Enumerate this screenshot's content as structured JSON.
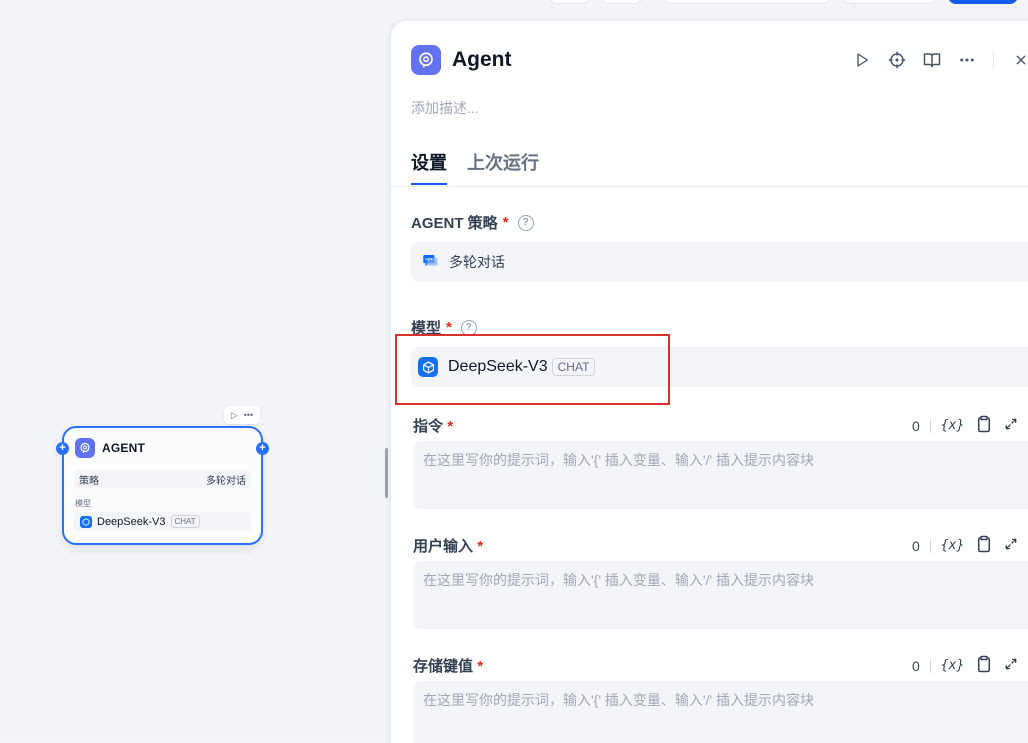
{
  "node": {
    "title": "AGENT",
    "strategy_label": "策略",
    "strategy_value": "多轮对话",
    "model_label": "模型",
    "model_name": "DeepSeek-V3",
    "model_badge": "CHAT",
    "handle_symbol": "+"
  },
  "panel": {
    "title": "Agent",
    "description_placeholder": "添加描述...",
    "tabs": [
      {
        "label": "设置",
        "active": true
      },
      {
        "label": "上次运行",
        "active": false
      }
    ],
    "strategy": {
      "label": "AGENT 策略",
      "required": "*",
      "help": "?",
      "value": "多轮对话"
    },
    "model": {
      "label": "模型",
      "required": "*",
      "help": "?",
      "name": "DeepSeek-V3",
      "badge": "CHAT"
    },
    "prompts": [
      {
        "label": "指令",
        "required": "*",
        "count": "0",
        "var_label": "{x}",
        "placeholder": "在这里写你的提示词，输入'{' 插入变量、输入'/' 插入提示内容块"
      },
      {
        "label": "用户输入",
        "required": "*",
        "count": "0",
        "var_label": "{x}",
        "placeholder": "在这里写你的提示词，输入'{' 插入变量、输入'/' 插入提示内容块"
      },
      {
        "label": "存储键值",
        "required": "*",
        "count": "0",
        "var_label": "{x}",
        "placeholder": "在这里写你的提示词，输入'{' 插入变量、输入'/' 插入提示内容块"
      }
    ]
  },
  "colors": {
    "accent": "#155aef",
    "node_border": "#2970ff",
    "agent_icon_bg": "#6172f3",
    "highlight": "#d9302c"
  }
}
